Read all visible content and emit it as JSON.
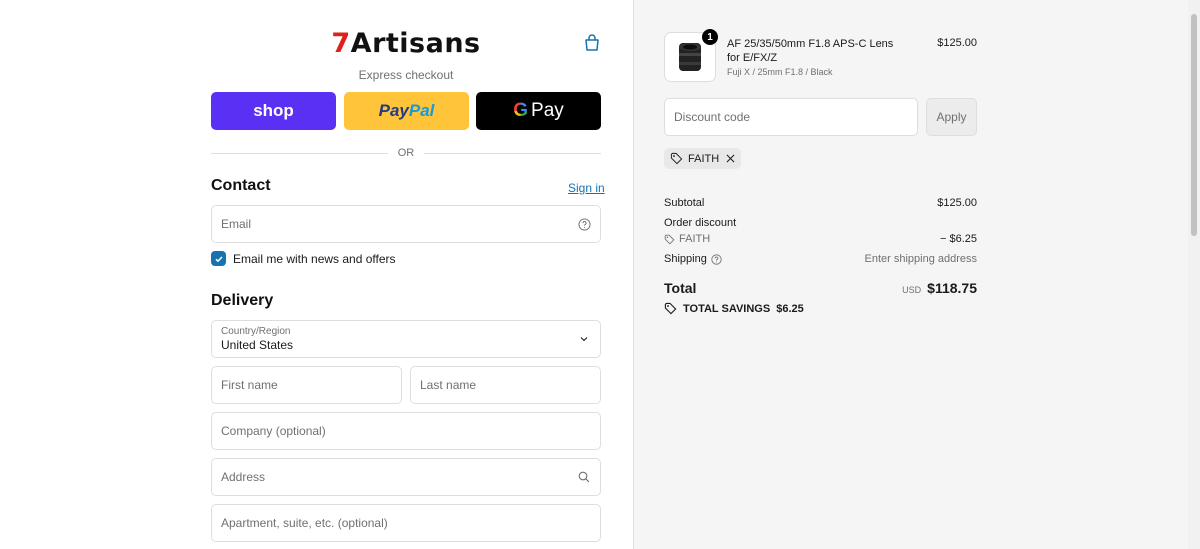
{
  "brand": {
    "logo_seven": "7",
    "logo_rest": "Artisans"
  },
  "express": {
    "label": "Express checkout",
    "shop_label": "shop",
    "paypal_part1": "Pay",
    "paypal_part2": "Pal",
    "gpay_g": "G",
    "gpay_label": "Pay"
  },
  "or_label": "OR",
  "contact": {
    "title": "Contact",
    "signin_label": "Sign in",
    "email_placeholder": "Email",
    "newsletter_label": "Email me with news and offers",
    "newsletter_checked": true
  },
  "delivery": {
    "title": "Delivery",
    "country_label": "Country/Region",
    "country_value": "United States",
    "first_name_placeholder": "First name",
    "last_name_placeholder": "Last name",
    "company_placeholder": "Company (optional)",
    "address_placeholder": "Address",
    "apartment_placeholder": "Apartment, suite, etc. (optional)"
  },
  "order": {
    "product_name": "AF 25/35/50mm F1.8 APS-C Lens for E/FX/Z",
    "product_variant": "Fuji X / 25mm F1.8 / Black",
    "product_price": "$125.00",
    "quantity": "1",
    "discount_placeholder": "Discount code",
    "apply_label": "Apply",
    "applied_code": "FAITH",
    "subtotal_label": "Subtotal",
    "subtotal_value": "$125.00",
    "order_discount_label": "Order discount",
    "discount_code_label": "FAITH",
    "discount_value": "− $6.25",
    "shipping_label": "Shipping",
    "shipping_value": "Enter shipping address",
    "total_label": "Total",
    "total_currency": "USD",
    "total_value": "$118.75",
    "savings_label": "TOTAL SAVINGS",
    "savings_value": "$6.25"
  },
  "colors": {
    "shop_purple": "#5a31f4",
    "paypal_yellow": "#ffc439",
    "link_blue": "#1773b0",
    "brand_red": "#e0201b"
  }
}
